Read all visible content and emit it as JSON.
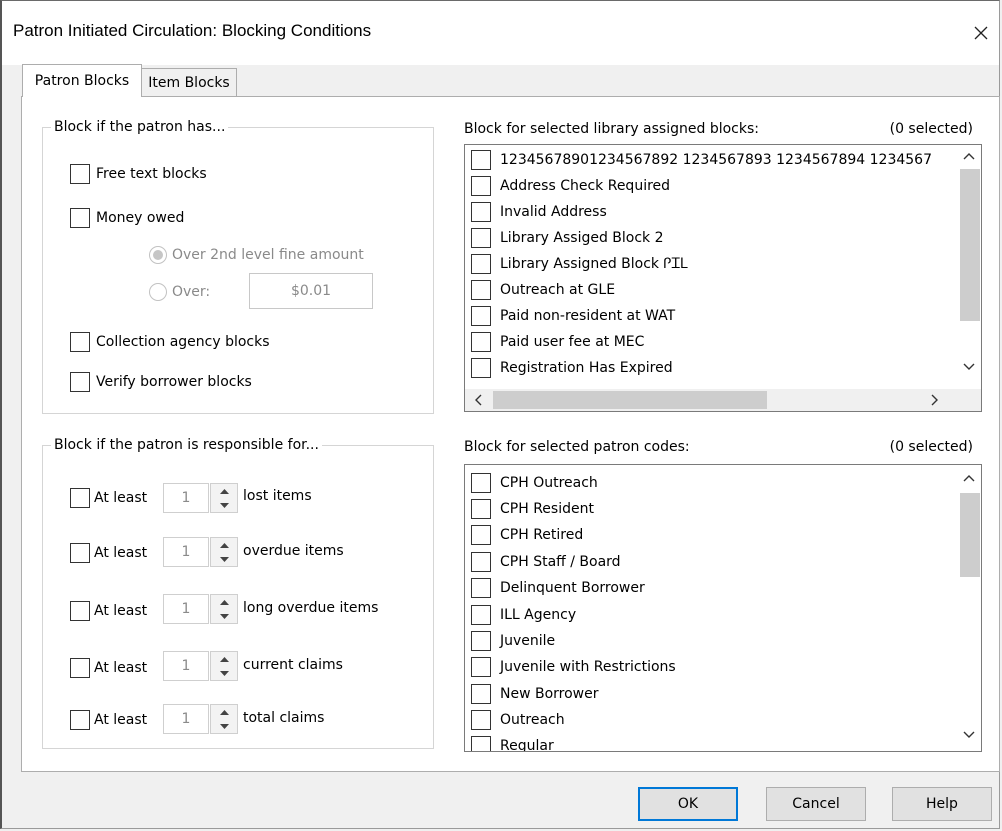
{
  "window": {
    "title": "Patron Initiated Circulation: Blocking Conditions"
  },
  "tabs": [
    {
      "label": "Patron Blocks",
      "active": true
    },
    {
      "label": "Item Blocks",
      "active": false
    }
  ],
  "patron_has": {
    "legend": "Block if the patron has...",
    "free_text": "Free text blocks",
    "money_owed": "Money owed",
    "over_2nd_level": "Over 2nd level fine amount",
    "over": "Over:",
    "over_amount": "$0.01",
    "collection_agency": "Collection agency blocks",
    "verify_borrower": "Verify borrower blocks"
  },
  "responsible_for": {
    "legend": "Block if the patron is responsible for...",
    "rows": [
      {
        "prefix": "At least",
        "value": "1",
        "suffix": "lost items"
      },
      {
        "prefix": "At least",
        "value": "1",
        "suffix": "overdue items"
      },
      {
        "prefix": "At least",
        "value": "1",
        "suffix": "long overdue items"
      },
      {
        "prefix": "At least",
        "value": "1",
        "suffix": "current claims"
      },
      {
        "prefix": "At least",
        "value": "1",
        "suffix": "total claims"
      }
    ]
  },
  "library_blocks": {
    "label": "Block for selected library assigned blocks:",
    "count": "(0 selected)",
    "items": [
      "12345678901234567892 1234567893 1234567894 1234567",
      "Address Check Required",
      "Invalid Address",
      "Library Assiged Block 2",
      "Library Assigned Block ᎵᏆᏞ",
      "Outreach at GLE",
      "Paid non-resident at WAT",
      "Paid user fee at MEC",
      "Registration Has Expired"
    ]
  },
  "patron_codes": {
    "label": "Block for selected patron codes:",
    "count": "(0 selected)",
    "items": [
      "CPH Outreach",
      "CPH Resident",
      "CPH Retired",
      "CPH Staff / Board",
      "Delinquent Borrower",
      "ILL Agency",
      "Juvenile",
      "Juvenile with Restrictions",
      "New Borrower",
      "Outreach",
      "Regular"
    ]
  },
  "buttons": {
    "ok": "OK",
    "cancel": "Cancel",
    "help": "Help"
  },
  "colors": {
    "default_button_border": "#0078d7",
    "disabled_text": "#8a8a8a"
  }
}
